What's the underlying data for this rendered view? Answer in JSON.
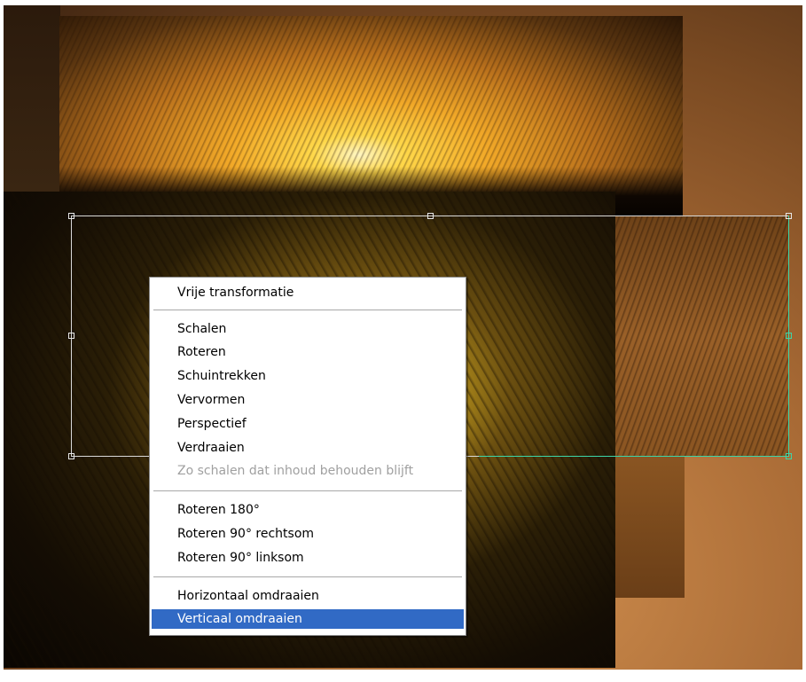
{
  "context_menu": {
    "items": [
      {
        "label": "Vrije transformatie",
        "enabled": true,
        "selected": false
      },
      {
        "label": "Schalen",
        "enabled": true,
        "selected": false
      },
      {
        "label": "Roteren",
        "enabled": true,
        "selected": false
      },
      {
        "label": "Schuintrekken",
        "enabled": true,
        "selected": false
      },
      {
        "label": "Vervormen",
        "enabled": true,
        "selected": false
      },
      {
        "label": "Perspectief",
        "enabled": true,
        "selected": false
      },
      {
        "label": "Verdraaien",
        "enabled": true,
        "selected": false
      },
      {
        "label": "Zo schalen dat inhoud behouden blijft",
        "enabled": false,
        "selected": false
      },
      {
        "label": "Roteren 180°",
        "enabled": true,
        "selected": false
      },
      {
        "label": "Roteren 90° rechtsom",
        "enabled": true,
        "selected": false
      },
      {
        "label": "Roteren 90° linksom",
        "enabled": true,
        "selected": false
      },
      {
        "label": "Horizontaal omdraaien",
        "enabled": true,
        "selected": false
      },
      {
        "label": "Verticaal omdraaien",
        "enabled": true,
        "selected": true
      }
    ]
  },
  "colors": {
    "selection_highlight": "#316ac5",
    "transform_box": "#d9d9d9",
    "transform_box_active_edge": "#3cd6a8",
    "disabled_text": "#a0a0a0"
  }
}
